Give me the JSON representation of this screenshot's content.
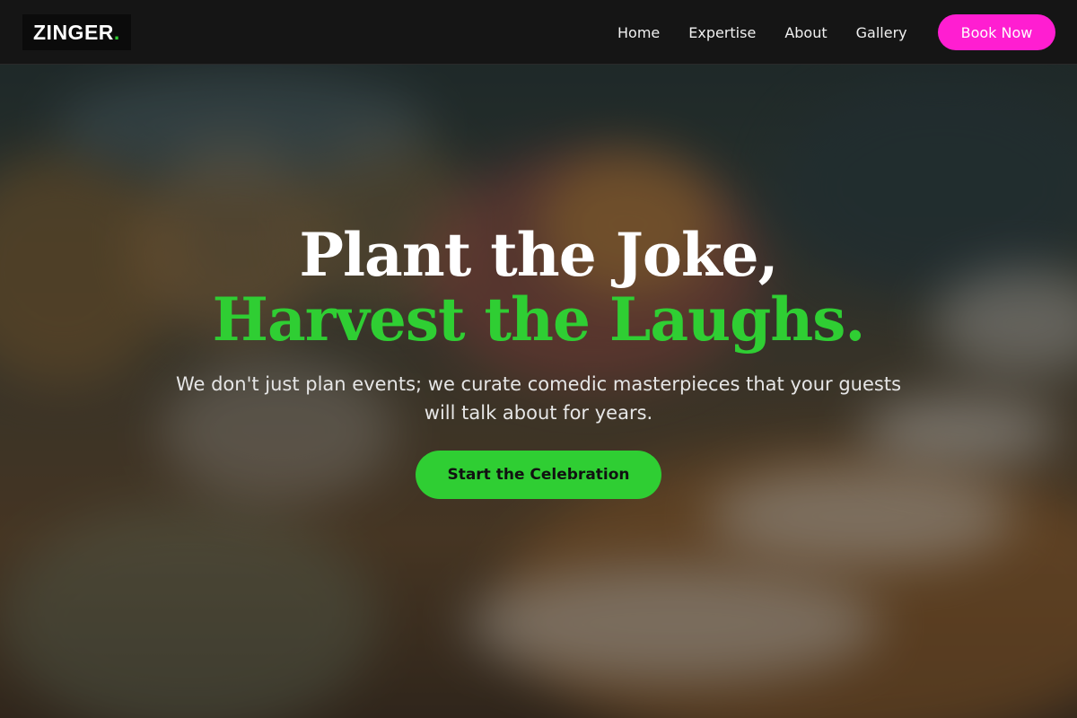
{
  "brand": {
    "name": "ZINGER",
    "dot": ".",
    "accent_color": "#2fce33"
  },
  "nav": {
    "links": [
      "Home",
      "Expertise",
      "About",
      "Gallery"
    ],
    "book_label": "Book Now",
    "book_color": "#ff1ed1"
  },
  "hero": {
    "headline_line1": "Plant the Joke,",
    "headline_line2": "Harvest the Laughs.",
    "subtext": "We don't just plan events; we curate comedic masterpieces that your guests will talk about for years.",
    "cta_label": "Start the Celebration",
    "background_image": "blurred banquet table with glasses, plates and flowers"
  }
}
